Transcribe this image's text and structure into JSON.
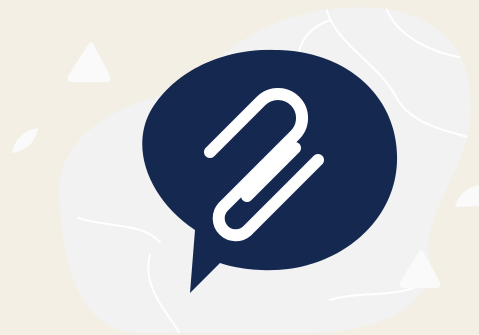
{
  "illustration": {
    "background_color": "#F3EFE5",
    "blob_color": "#F2F2F2",
    "contour_line_color": "#FFFFFF",
    "decoration_color": "#FAFAFA",
    "bubble_color": "#152850",
    "icon_color": "#FFFFFF",
    "icon": "paperclip-icon",
    "container_icon": "speech-bubble-icon"
  }
}
